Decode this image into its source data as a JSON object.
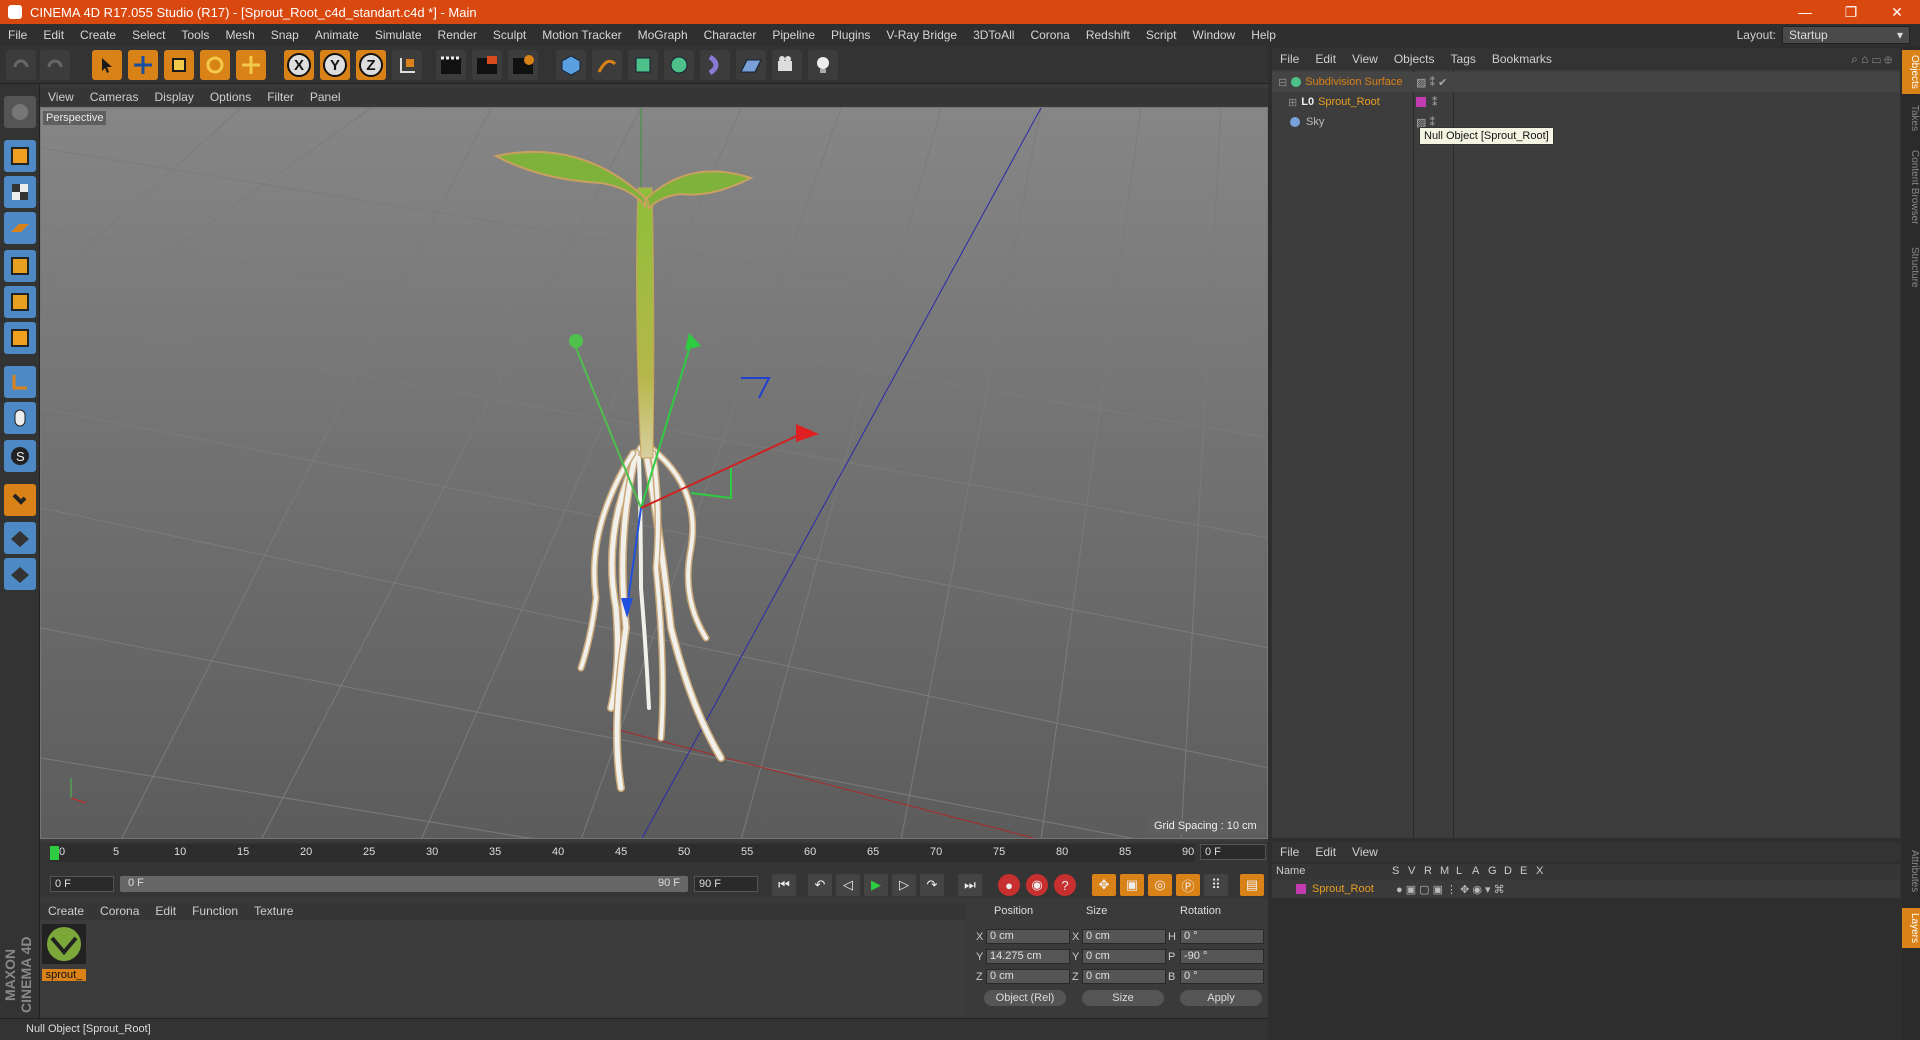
{
  "titlebar": {
    "title": "CINEMA 4D R17.055 Studio (R17) - [Sprout_Root_c4d_standart.c4d *] - Main",
    "minimize": "—",
    "restore": "❐",
    "close": "✕"
  },
  "menubar": {
    "items": [
      "File",
      "Edit",
      "Create",
      "Select",
      "Tools",
      "Mesh",
      "Snap",
      "Animate",
      "Simulate",
      "Render",
      "Sculpt",
      "Motion Tracker",
      "MoGraph",
      "Character",
      "Pipeline",
      "Plugins",
      "V-Ray Bridge",
      "3DToAll",
      "Corona",
      "Redshift",
      "Script",
      "Window",
      "Help"
    ],
    "layout_label": "Layout:",
    "layout_value": "Startup"
  },
  "toolbar": {
    "x": "X",
    "y": "Y",
    "z": "Z"
  },
  "viewport": {
    "menu": [
      "View",
      "Cameras",
      "Display",
      "Options",
      "Filter",
      "Panel"
    ],
    "label": "Perspective",
    "grid_spacing": "Grid Spacing : 10 cm"
  },
  "timeline": {
    "ticks": [
      "0",
      "5",
      "10",
      "15",
      "20",
      "25",
      "30",
      "35",
      "40",
      "45",
      "50",
      "55",
      "60",
      "65",
      "70",
      "75",
      "80",
      "85",
      "90"
    ],
    "current_frame": "0 F",
    "start": "0 F",
    "range_start": "0 F",
    "range_end": "90 F",
    "end": "90 F"
  },
  "materials": {
    "menu": [
      "Create",
      "Corona",
      "Edit",
      "Function",
      "Texture"
    ],
    "mat_name": "sprout_"
  },
  "coords": {
    "headers": {
      "position": "Position",
      "size": "Size",
      "rotation": "Rotation"
    },
    "rows": [
      {
        "axis": "X",
        "pos": "0 cm",
        "saxis": "X",
        "size": "0 cm",
        "raxis": "H",
        "rot": "0 °"
      },
      {
        "axis": "Y",
        "pos": "14.275 cm",
        "saxis": "Y",
        "size": "0 cm",
        "raxis": "P",
        "rot": "-90 °"
      },
      {
        "axis": "Z",
        "pos": "0 cm",
        "saxis": "Z",
        "size": "0 cm",
        "raxis": "B",
        "rot": "0 °"
      }
    ],
    "mode": "Object (Rel)",
    "size_mode": "Size",
    "apply": "Apply"
  },
  "status": "Null Object [Sprout_Root]",
  "logo": "MAXON CINEMA 4D",
  "objects": {
    "menu": [
      "File",
      "Edit",
      "View",
      "Objects",
      "Tags",
      "Bookmarks"
    ],
    "items": [
      {
        "name": "Subdivision Surface",
        "color": "#d98218"
      },
      {
        "name": "Sprout_Root",
        "color": "#e8a020"
      },
      {
        "name": "Sky",
        "color": "#bbbbbb"
      }
    ],
    "tooltip": "Null Object [Sprout_Root]"
  },
  "layers": {
    "menu": [
      "File",
      "Edit",
      "View"
    ],
    "name_col": "Name",
    "cols": [
      "S",
      "V",
      "R",
      "M",
      "L",
      "A",
      "G",
      "D",
      "E",
      "X"
    ],
    "item": "Sprout_Root"
  },
  "sidetabs": [
    "Objects",
    "Takes",
    "Content Browser",
    "Structure",
    "Attributes",
    "Layers"
  ]
}
